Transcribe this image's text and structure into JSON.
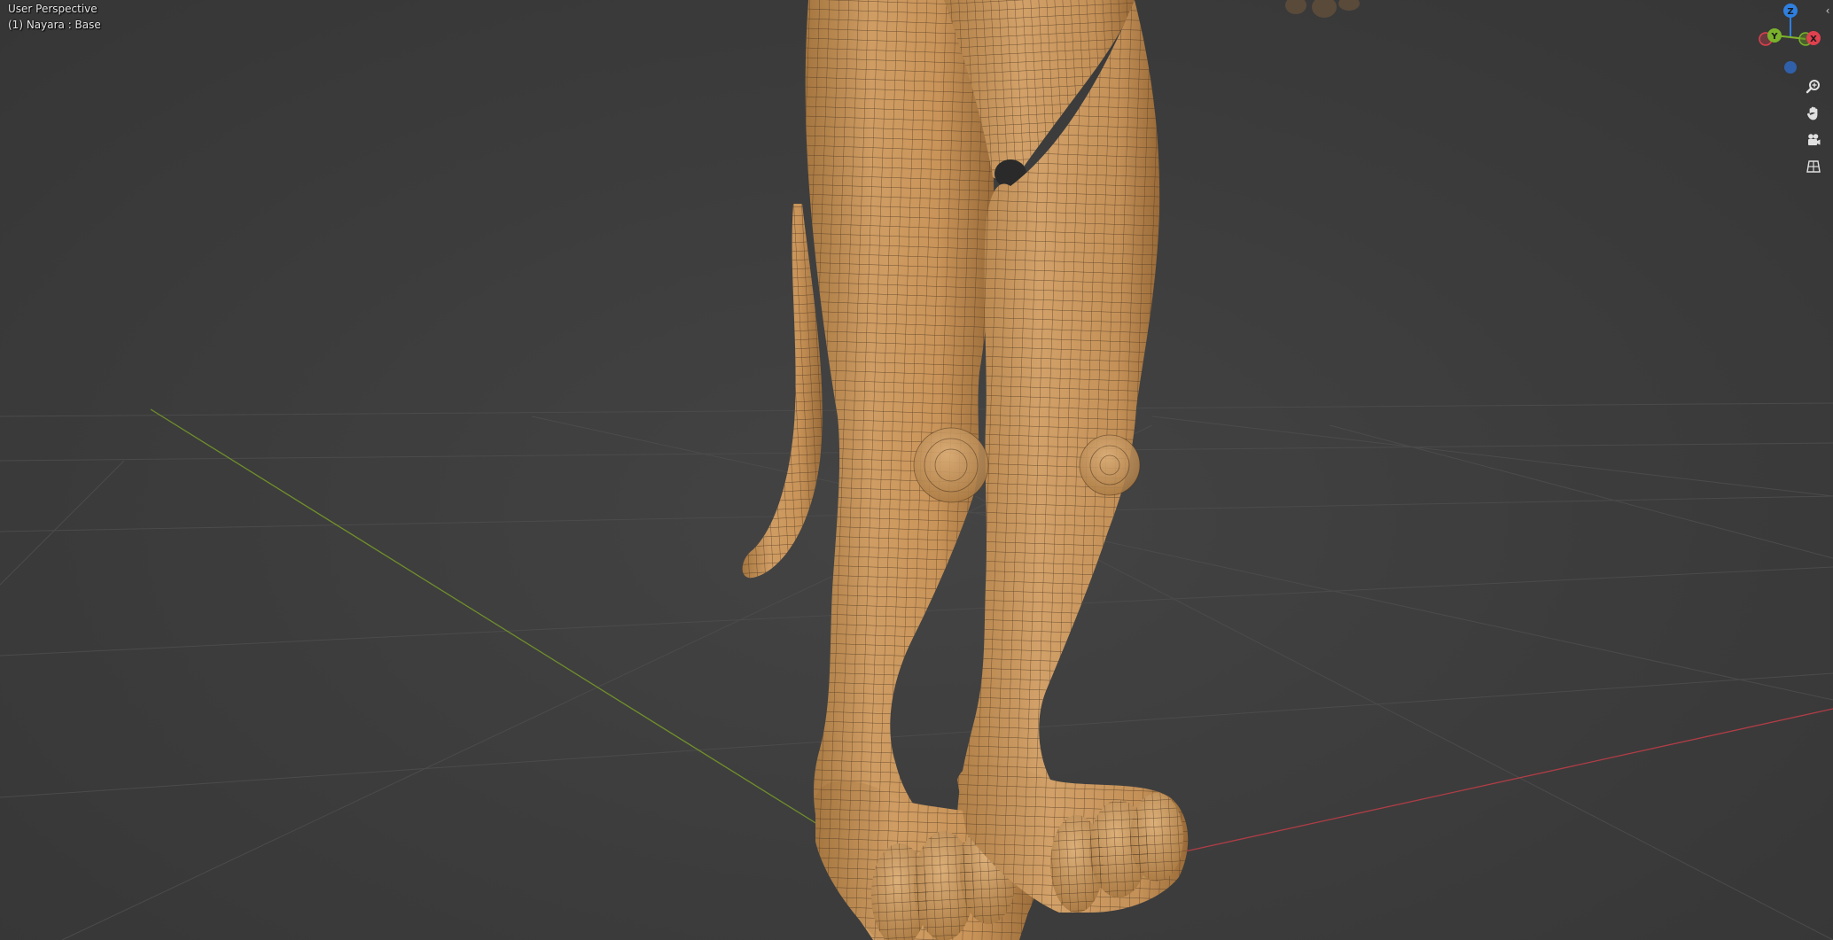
{
  "viewport": {
    "view_name": "User Perspective",
    "object_info": "(1) Nayara : Base"
  },
  "gizmo": {
    "axes": [
      {
        "label": "Z",
        "color": "#2f7fe0"
      },
      {
        "label": "Y",
        "color": "#7ab32b"
      },
      {
        "label": "X",
        "color": "#e0414f"
      }
    ],
    "navigation": [
      {
        "name": "zoom-icon"
      },
      {
        "name": "pan-hand-icon"
      },
      {
        "name": "camera-icon"
      },
      {
        "name": "ortho-grid-icon"
      }
    ]
  },
  "colors": {
    "background": "#3d3d3d",
    "grid": "#4c4c4c",
    "x_axis": "#b8434a",
    "y_axis": "#7a9a2e",
    "mesh_skin": "#c9975e",
    "mesh_wire": "#4a3520"
  }
}
